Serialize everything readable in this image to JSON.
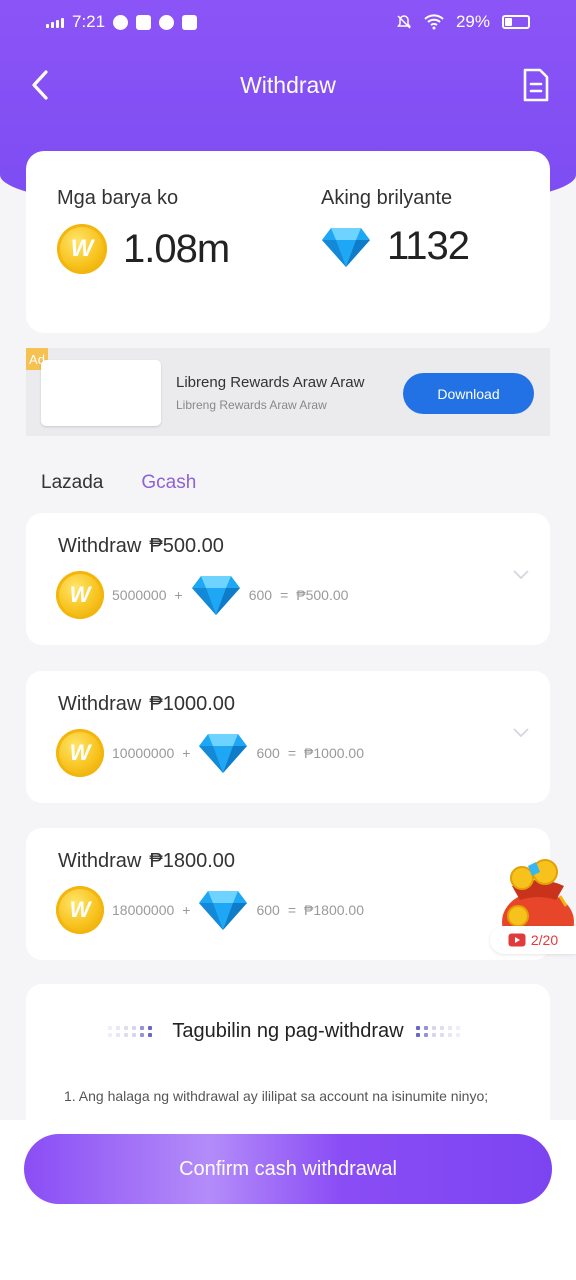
{
  "status_bar": {
    "time": "7:21",
    "battery": "29%"
  },
  "nav": {
    "title": "Withdraw"
  },
  "balance": {
    "coins_label": "Mga barya ko",
    "coins_value": "1.08m",
    "diamonds_label": "Aking brilyante",
    "diamonds_value": "1132"
  },
  "ad": {
    "tag": "Ad",
    "title": "Libreng Rewards Araw Araw",
    "subtitle": "Libreng Rewards Araw Araw",
    "button": "Download"
  },
  "tabs": [
    {
      "label": "Lazada",
      "active": false
    },
    {
      "label": "Gcash",
      "active": true
    }
  ],
  "withdraw_options": [
    {
      "label": "Withdraw",
      "amount": "₱500.00",
      "coins": "5000000",
      "plus": "+",
      "diamonds": "600",
      "equals": "=",
      "result": "₱500.00"
    },
    {
      "label": "Withdraw",
      "amount": "₱1000.00",
      "coins": "10000000",
      "plus": "+",
      "diamonds": "600",
      "equals": "=",
      "result": "₱1000.00"
    },
    {
      "label": "Withdraw",
      "amount": "₱1800.00",
      "coins": "18000000",
      "plus": "+",
      "diamonds": "600",
      "equals": "=",
      "result": "₱1800.00"
    }
  ],
  "gift": {
    "count": "2/20"
  },
  "instructions": {
    "title": "Tagubilin ng pag-withdraw",
    "line1": "1. Ang halaga ng withdrawal ay ililipat sa account na isinumite ninyo;"
  },
  "confirm_button": "Confirm cash withdrawal",
  "colors": {
    "header": "#8b54f7",
    "active_tab": "#8d62d8",
    "download_button": "#2272e6",
    "coin": "#f7c21c",
    "diamond": "#1ea7f5"
  }
}
